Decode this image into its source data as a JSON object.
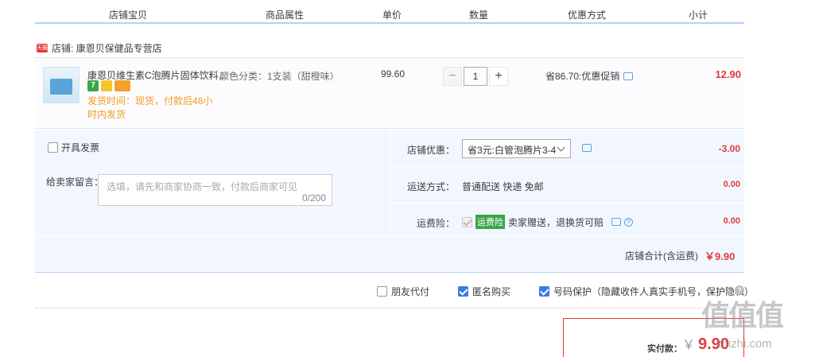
{
  "columns": [
    "店铺宝贝",
    "商品属性",
    "单价",
    "数量",
    "优惠方式",
    "小计"
  ],
  "shop": {
    "badge": "天猫",
    "name": "店铺: 康恩贝保健品专营店"
  },
  "item": {
    "title": "康恩贝维生素C泡腾片固体饮料...",
    "badge1": "7",
    "shipping": "发货时间：现货，付款后48小时内发货",
    "attribute": "颜色分类：1支装（甜橙味）",
    "unit_price": "99.60",
    "quantity": "1",
    "minus": "−",
    "plus": "+",
    "promo": "省86.70:优惠促销",
    "subtotal": "12.90"
  },
  "invoice": {
    "label": "开具发票",
    "checked": false
  },
  "message": {
    "label": "给卖家留言：",
    "placeholder": "选填，请先和商家协商一致，付款后商家可见",
    "counter": "0/200"
  },
  "shop_discount": {
    "label": "店铺优惠：",
    "selected": "省3元:白管泡腾片3-4",
    "amount": "-3.00"
  },
  "delivery": {
    "label": "运送方式：",
    "value": "普通配送 快递 免邮",
    "amount": "0.00"
  },
  "insurance": {
    "label": "运费险：",
    "tag": "运费险",
    "value": "卖家赠送，退换货可赔",
    "help": "?",
    "amount": "0.00"
  },
  "shop_total": {
    "label": "店铺合计(含运费)",
    "value": "￥9.90"
  },
  "extras": [
    {
      "label": "朋友代付",
      "checked": false
    },
    {
      "label": "匿名购买",
      "checked": true
    },
    {
      "label": "号码保护（隐藏收件人真实手机号，保护隐私）",
      "checked": true
    }
  ],
  "qmark": "?",
  "payment": {
    "label": "实付款：",
    "currency": "￥",
    "value": "9.90"
  },
  "watermark": {
    "glyphs": "值值值",
    "site": "zhizhi.com"
  },
  "colors": {
    "accent": "#3c78e6",
    "price": "#e4393c",
    "shipping": "#f29b22"
  }
}
